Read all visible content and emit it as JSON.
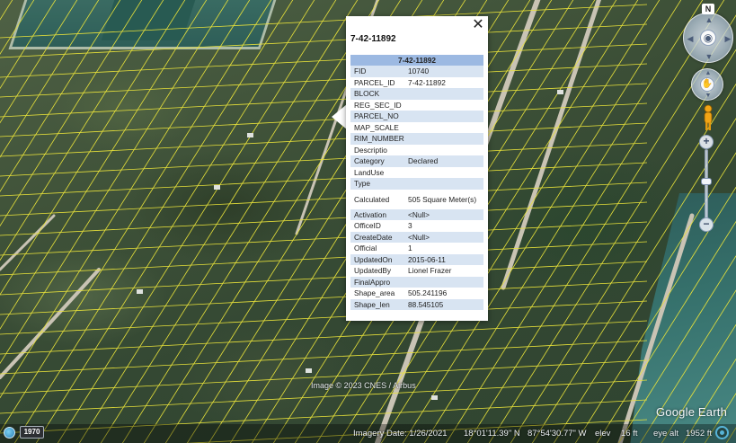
{
  "popup": {
    "title": "7-42-11892",
    "table_header": "7-42-11892",
    "close_glyph": "✕",
    "rows": [
      {
        "key": "FID",
        "value": "10740"
      },
      {
        "key": "PARCEL_ID",
        "value": "7-42-11892"
      },
      {
        "key": "BLOCK",
        "value": ""
      },
      {
        "key": "REG_SEC_ID",
        "value": ""
      },
      {
        "key": "PARCEL_NO",
        "value": ""
      },
      {
        "key": "MAP_SCALE",
        "value": ""
      },
      {
        "key": "RIM_NUMBER",
        "value": ""
      },
      {
        "key": "Descriptio",
        "value": ""
      },
      {
        "key": "Category",
        "value": "Declared"
      },
      {
        "key": "LandUse",
        "value": ""
      },
      {
        "key": "Type",
        "value": ""
      },
      {
        "key": "Calculated",
        "value": "505 Square Meter(s)"
      },
      {
        "key": "Activation",
        "value": "<Null>"
      },
      {
        "key": "OfficeID",
        "value": "3"
      },
      {
        "key": "CreateDate",
        "value": "<Null>"
      },
      {
        "key": "Official",
        "value": "1"
      },
      {
        "key": "UpdatedOn",
        "value": "2015-06-11"
      },
      {
        "key": "UpdatedBy",
        "value": "Lionel Frazer"
      },
      {
        "key": "FinalAppro",
        "value": ""
      },
      {
        "key": "Shape_area",
        "value": "505.241196"
      },
      {
        "key": "Shape_len",
        "value": "88.545105"
      }
    ]
  },
  "navigation": {
    "compass_label": "N",
    "look_icon": "eye-icon",
    "move_icon": "hand-icon",
    "pegman_icon": "pegman-icon",
    "zoom_in": "+",
    "zoom_out": "−"
  },
  "map": {
    "copyright": "Image © 2023 CNES / Airbus",
    "logo": "Google Earth",
    "historical_year": "1970",
    "imagery_date": "Imagery Date: 1/26/2021",
    "latitude": "18°01'11.39\" N",
    "longitude": "87°54'30.77\" W",
    "elev_label": "elev",
    "elev_value": "16 ft",
    "eye_alt_label": "eye alt",
    "eye_alt_value": "1952 ft",
    "parcel_line_color": "#e8e23a",
    "road_color": "#c9c3b4"
  }
}
